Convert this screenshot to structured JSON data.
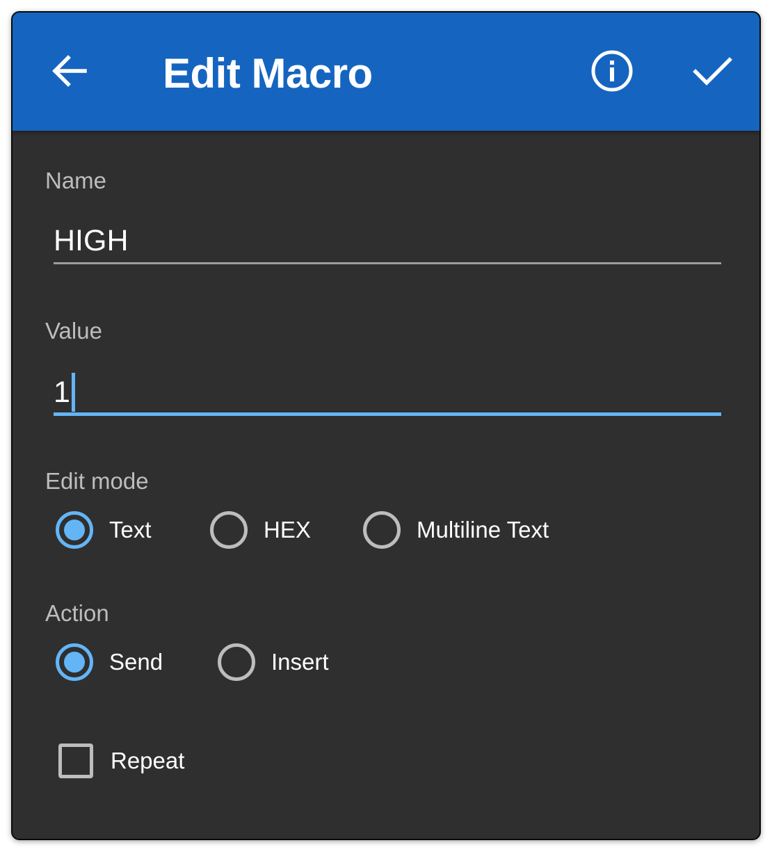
{
  "appbar": {
    "title": "Edit Macro",
    "back_icon": "arrow-left-icon",
    "info_icon": "info-circle-icon",
    "confirm_icon": "checkmark-icon"
  },
  "form": {
    "name": {
      "label": "Name",
      "value": "HIGH"
    },
    "value": {
      "label": "Value",
      "value": "1"
    },
    "edit_mode": {
      "label": "Edit mode",
      "options": [
        "Text",
        "HEX",
        "Multiline Text"
      ],
      "selected": "Text"
    },
    "action": {
      "label": "Action",
      "options": [
        "Send",
        "Insert"
      ],
      "selected": "Send"
    },
    "repeat": {
      "label": "Repeat",
      "checked": false
    }
  },
  "colors": {
    "appbar": "#1565c0",
    "background": "#2f2f2f",
    "accent": "#64b5f6",
    "label": "#bdbdbd",
    "text": "#ffffff"
  }
}
